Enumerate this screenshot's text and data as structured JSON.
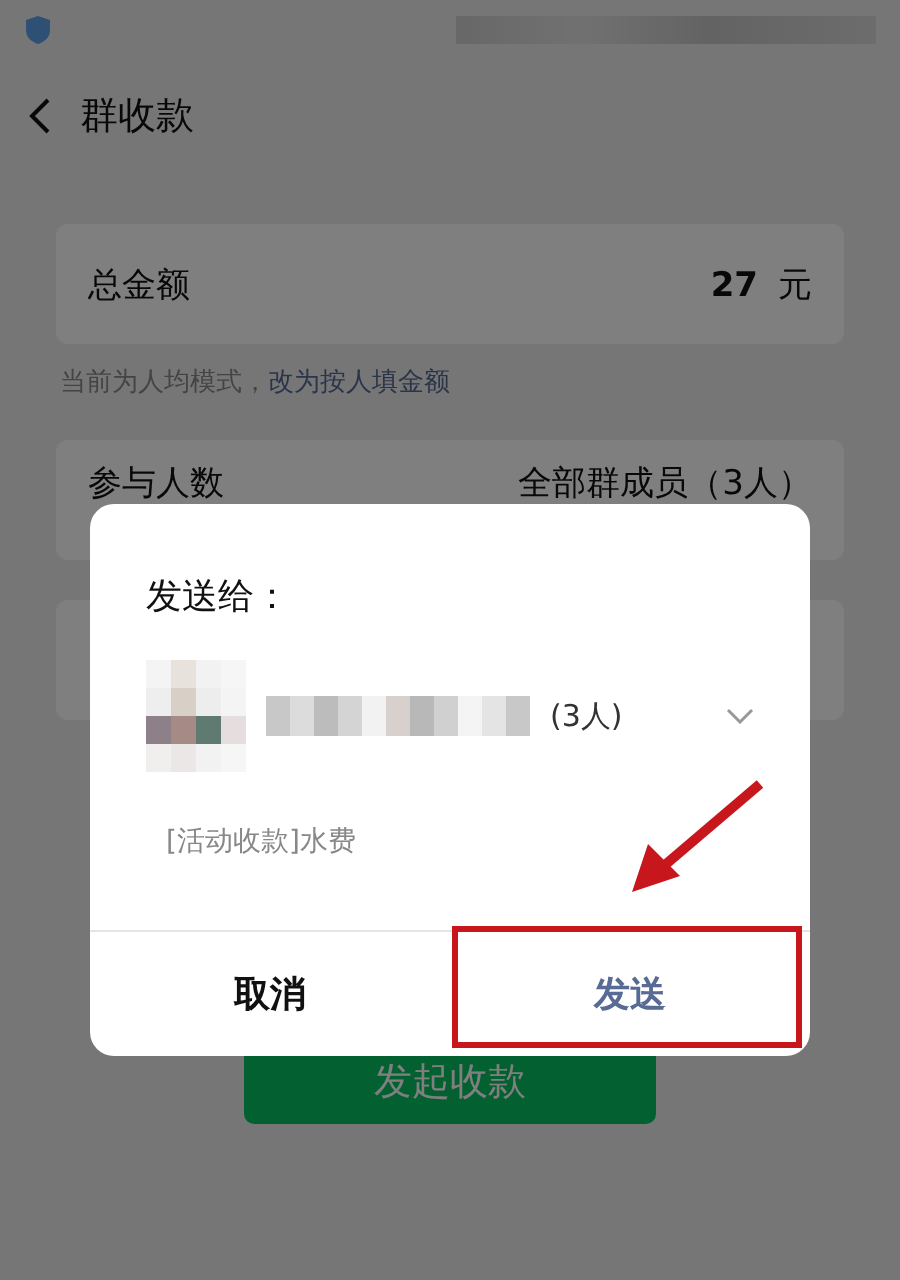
{
  "header": {
    "title": "群收款"
  },
  "amount_card": {
    "label": "总金额",
    "value": "27",
    "unit": "元"
  },
  "mode_hint": {
    "text": "当前为人均模式，",
    "link": "改为按人填金额"
  },
  "members_card": {
    "label": "参与人数",
    "value": "全部群成员（3人）"
  },
  "start_button": "发起收款",
  "dialog": {
    "title": "发送给：",
    "recipient_count": "(3人)",
    "message": "[活动收款]水费",
    "buttons": [
      {
        "label": "取消",
        "kind": "cancel"
      },
      {
        "label": "发送",
        "kind": "confirm"
      }
    ]
  }
}
